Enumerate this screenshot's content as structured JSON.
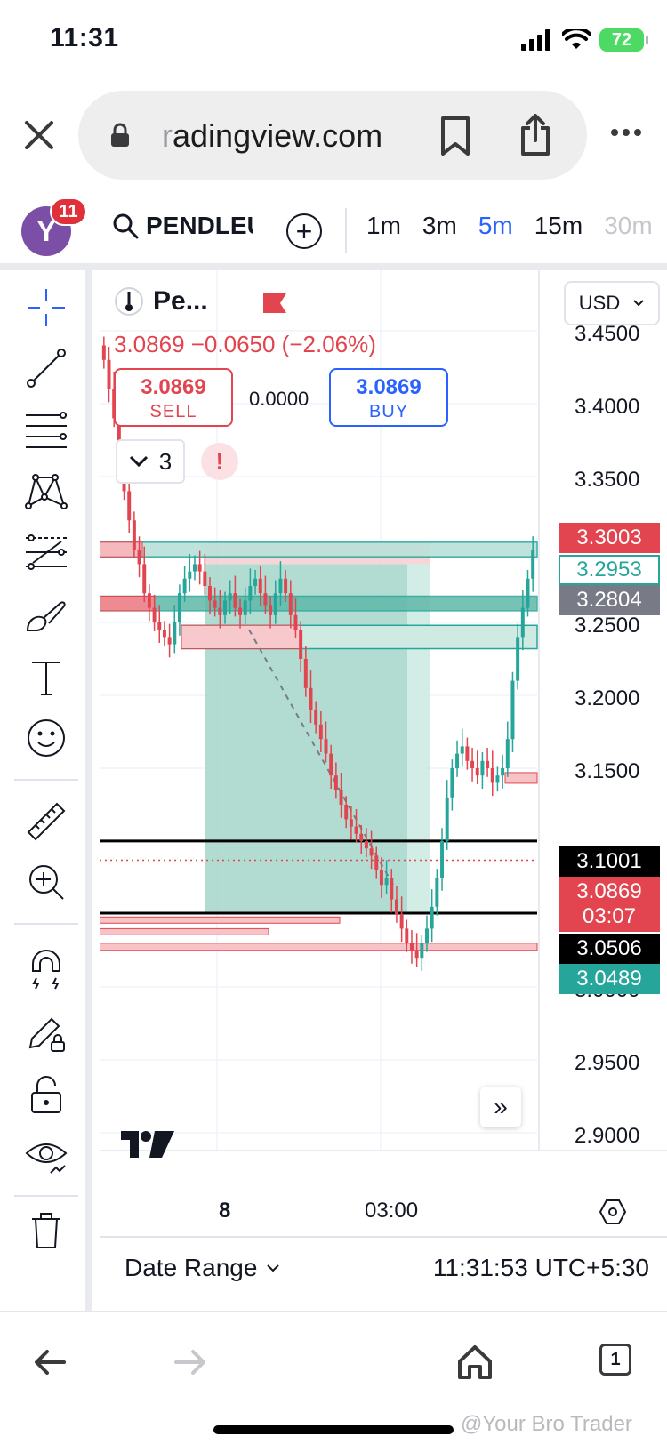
{
  "status_bar": {
    "time": "11:31",
    "battery": "72"
  },
  "browser": {
    "url_faded": "r",
    "url": "adingview.com",
    "nav": {
      "tabs_count": "1"
    },
    "watermark": "@Your Bro Trader"
  },
  "tv": {
    "avatar_letter": "Y",
    "notifications": "11",
    "symbol": "PENDLEU",
    "intervals": [
      "1m",
      "3m",
      "5m",
      "15m",
      "30m"
    ],
    "active_interval": "5m",
    "legend_title": "Pe...",
    "quote": "3.0869  −0.0650 (−2.06%)",
    "sell_price": "3.0869",
    "sell_label": "SELL",
    "spread": "0.0000",
    "buy_price": "3.0869",
    "buy_label": "BUY",
    "indicators_count": "3",
    "alert_mark": "!",
    "currency": "USD",
    "price_ticks": [
      "3.4500",
      "3.4000",
      "3.3500",
      "3.2500",
      "3.2000",
      "3.1500",
      "3.0000",
      "2.9500",
      "2.9000"
    ],
    "price_labels": {
      "l3003": "3.3003",
      "l2953": "3.2953",
      "l2804": "3.2804",
      "l1001": "3.1001",
      "l0869": "3.0869",
      "countdown": "03:07",
      "l0506": "3.0506",
      "l0489": "3.0489"
    },
    "time_ticks": [
      "8",
      "03:00"
    ],
    "date_range": "Date Range",
    "clock": "11:31:53 UTC+5:30",
    "goto_realtime": "»"
  },
  "colors": {
    "up": "#26a69a",
    "down": "#e2454f",
    "accent": "#2962ff",
    "long_profit_zone": "#9fd3c7",
    "price_label_grey": "#787b86"
  },
  "chart_data": {
    "type": "candlestick",
    "ylim": [
      2.88,
      3.47
    ],
    "y_ticks": [
      3.45,
      3.4,
      3.35,
      3.25,
      3.2,
      3.15,
      3.0,
      2.95,
      2.9
    ],
    "x_ticks": [
      "8",
      "03:00"
    ],
    "horizontal_lines": [
      3.1001,
      3.0506
    ],
    "current_price": 3.0869,
    "marked_prices": [
      3.3003,
      3.2953,
      3.2804,
      3.1001,
      3.0869,
      3.0506,
      3.0489
    ],
    "closes": [
      3.43,
      3.41,
      3.39,
      3.36,
      3.34,
      3.32,
      3.3,
      3.29,
      3.27,
      3.26,
      3.25,
      3.245,
      3.24,
      3.235,
      3.25,
      3.27,
      3.28,
      3.285,
      3.29,
      3.285,
      3.275,
      3.265,
      3.26,
      3.255,
      3.265,
      3.27,
      3.26,
      3.255,
      3.265,
      3.275,
      3.28,
      3.27,
      3.262,
      3.255,
      3.27,
      3.28,
      3.27,
      3.255,
      3.245,
      3.225,
      3.205,
      3.19,
      3.18,
      3.17,
      3.16,
      3.145,
      3.135,
      3.125,
      3.115,
      3.11,
      3.105,
      3.1,
      3.095,
      3.09,
      3.08,
      3.07,
      3.075,
      3.06,
      3.05,
      3.04,
      3.03,
      3.025,
      3.02,
      3.03,
      3.04,
      3.055,
      3.075,
      3.1,
      3.13,
      3.15,
      3.16,
      3.165,
      3.155,
      3.15,
      3.145,
      3.155,
      3.15,
      3.14,
      3.145,
      3.15,
      3.17,
      3.21,
      3.24,
      3.26,
      3.28,
      3.3
    ]
  }
}
